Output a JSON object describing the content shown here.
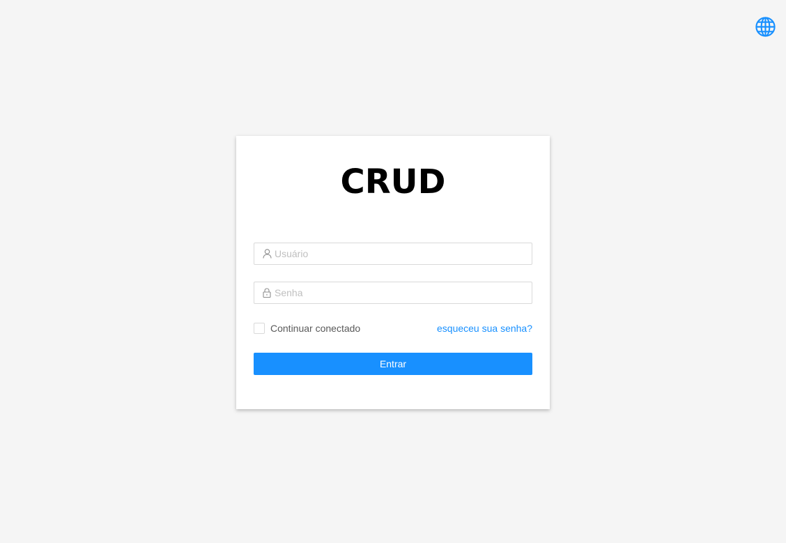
{
  "header": {
    "language_icon": "globe-icon"
  },
  "login": {
    "title": "CRUD",
    "username": {
      "icon": "user-icon",
      "placeholder": "Usuário",
      "value": ""
    },
    "password": {
      "icon": "lock-icon",
      "placeholder": "Senha",
      "value": ""
    },
    "remember_label": "Continuar conectado",
    "remember_checked": false,
    "forgot_label": "esqueceu sua senha?",
    "submit_label": "Entrar"
  },
  "colors": {
    "background": "#f5f5f5",
    "primary": "#1890ff",
    "card": "#ffffff",
    "border": "#d9d9d9",
    "placeholder": "#bfbfbf"
  }
}
